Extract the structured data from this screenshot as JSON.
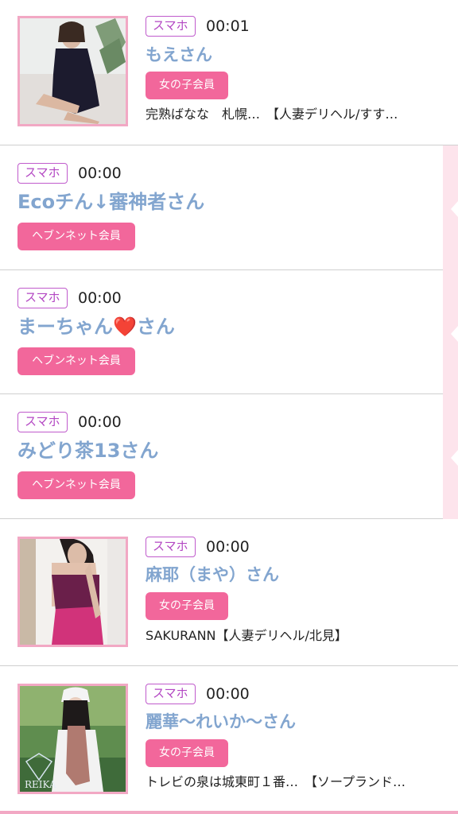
{
  "entries": [
    {
      "device": "スマホ",
      "time": "00:01",
      "name": "もえさん",
      "badge": "女の子会員",
      "shop": "完熟ばなな　札幌…　【人妻デリヘル/すす…"
    },
    {
      "device": "スマホ",
      "time": "00:00",
      "name": "Ecoチん↓審神者さん",
      "badge": "ヘブンネット会員"
    },
    {
      "device": "スマホ",
      "time": "00:00",
      "name": "まーちゃん❤️さん",
      "badge": "ヘブンネット会員"
    },
    {
      "device": "スマホ",
      "time": "00:00",
      "name": "みどり茶13さん",
      "badge": "ヘブンネット会員"
    },
    {
      "device": "スマホ",
      "time": "00:00",
      "name": "麻耶（まや）さん",
      "badge": "女の子会員",
      "shop": "SAKURANN【人妻デリヘル/北見】"
    },
    {
      "device": "スマホ",
      "time": "00:00",
      "name": "麗華～れいか～さん",
      "badge": "女の子会員",
      "shop": "トレビの泉は城東町１番…　【ソープランド…"
    }
  ],
  "colors": {
    "name": "#82a5cf",
    "badge": "#f2679b",
    "device_border": "#c05bcc",
    "thumb_border": "#f2a8c4"
  },
  "photo_watermark": "REIKA"
}
